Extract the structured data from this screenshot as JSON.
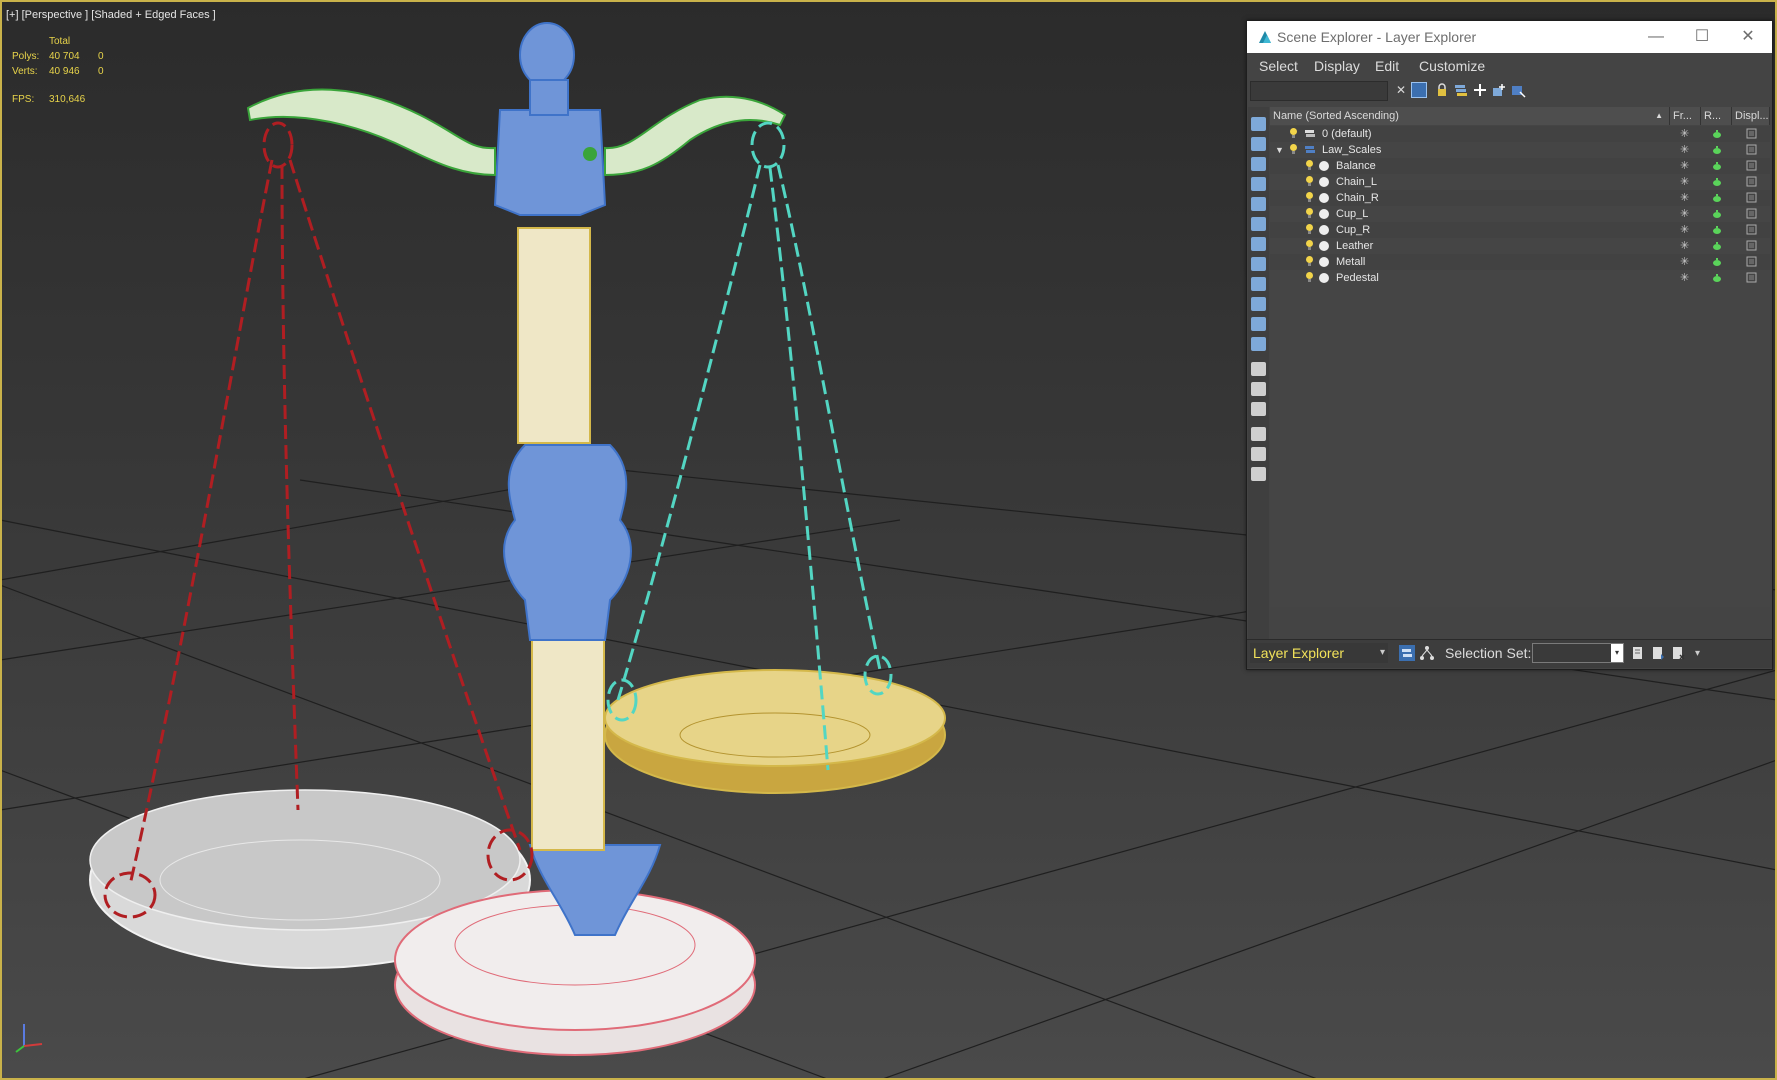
{
  "viewport": {
    "label": "[+] [Perspective ] [Shaded + Edged Faces ]",
    "stats": {
      "total_label": "Total",
      "polys_label": "Polys:",
      "polys_total": "40 704",
      "polys_selected": "0",
      "verts_label": "Verts:",
      "verts_total": "40 946",
      "verts_selected": "0",
      "fps_label": "FPS:",
      "fps_value": "310,646"
    },
    "axis": {
      "x": "x",
      "y": "y",
      "z": "z"
    },
    "colors": {
      "grid_line": "#1f1f1f",
      "chain_left": "#b01e22",
      "chain_right": "#53d6c3",
      "balance_beam": "#3aa43a",
      "balance_fill": "#d8e9c9",
      "column_blue": "#3f73c9",
      "column_cream": "#efe7c6",
      "cup_left": "#e0e0e0",
      "cup_right": "#d4b84a",
      "pedestal": "#e06b78",
      "viewport_border": "#c9b24a"
    }
  },
  "scene_explorer": {
    "title": "Scene Explorer - Layer Explorer",
    "window_buttons": {
      "minimize": "—",
      "maximize": "☐",
      "close": "✕"
    },
    "menu": [
      "Select",
      "Display",
      "Edit",
      "Customize"
    ],
    "search": {
      "value": ""
    },
    "toolbar": {
      "clear": "✕"
    },
    "columns": {
      "name": "Name (Sorted Ascending)",
      "sort_arrow": "▲",
      "frozen": "Fr...",
      "render": "R...",
      "display": "Displ..."
    },
    "rows": [
      {
        "name": "0 (default)",
        "type": "layer",
        "expanded": false
      },
      {
        "name": "Law_Scales",
        "type": "layer",
        "expanded": true,
        "toggle": "▼"
      },
      {
        "name": "Balance",
        "type": "object"
      },
      {
        "name": "Chain_L",
        "type": "object"
      },
      {
        "name": "Chain_R",
        "type": "object"
      },
      {
        "name": "Cup_L",
        "type": "object"
      },
      {
        "name": "Cup_R",
        "type": "object"
      },
      {
        "name": "Leather",
        "type": "object"
      },
      {
        "name": "Metall",
        "type": "object"
      },
      {
        "name": "Pedestal",
        "type": "object"
      }
    ],
    "bottom": {
      "explorer_type": "Layer Explorer",
      "explorer_arrow": "▾",
      "selection_set_label": "Selection Set:",
      "selection_set_value": "",
      "selection_set_arrow": "▾",
      "menu_arrow": "▾"
    },
    "accent_color": "#f2e25a"
  }
}
